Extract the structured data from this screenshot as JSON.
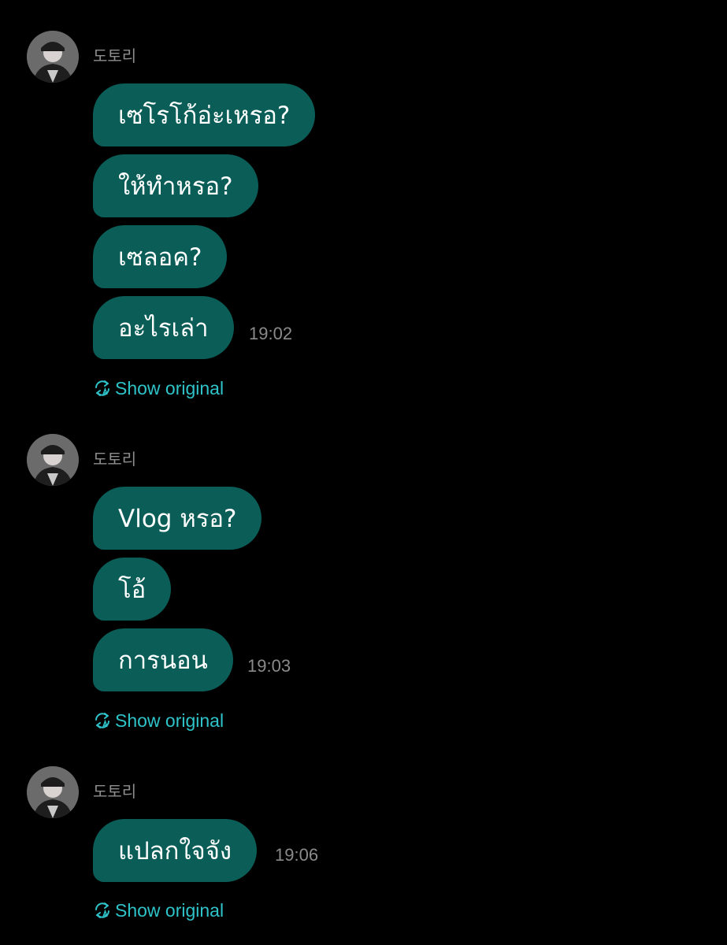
{
  "groups": [
    {
      "sender": "도토리",
      "messages": [
        "เซโรโก้อ่ะเหรอ?",
        "ให้ทำหรอ?",
        "เซลอค?",
        "อะไรเล่า"
      ],
      "time": "19:02",
      "show_original": "Show original"
    },
    {
      "sender": "도토리",
      "messages": [
        "Vlog หรอ?",
        "โอ้",
        "การนอน"
      ],
      "time": "19:03",
      "show_original": "Show original"
    },
    {
      "sender": "도토리",
      "messages": [
        "แปลกใจจัง"
      ],
      "time": "19:06",
      "show_original": "Show original"
    }
  ],
  "icons": {
    "avatar": "user-avatar-photo",
    "translate": "translate-refresh-icon"
  },
  "colors": {
    "background": "#000000",
    "bubble": "#0b5d58",
    "link": "#2ec4c9",
    "timestamp": "#8a8a8a",
    "sender": "#8e8e8e"
  }
}
